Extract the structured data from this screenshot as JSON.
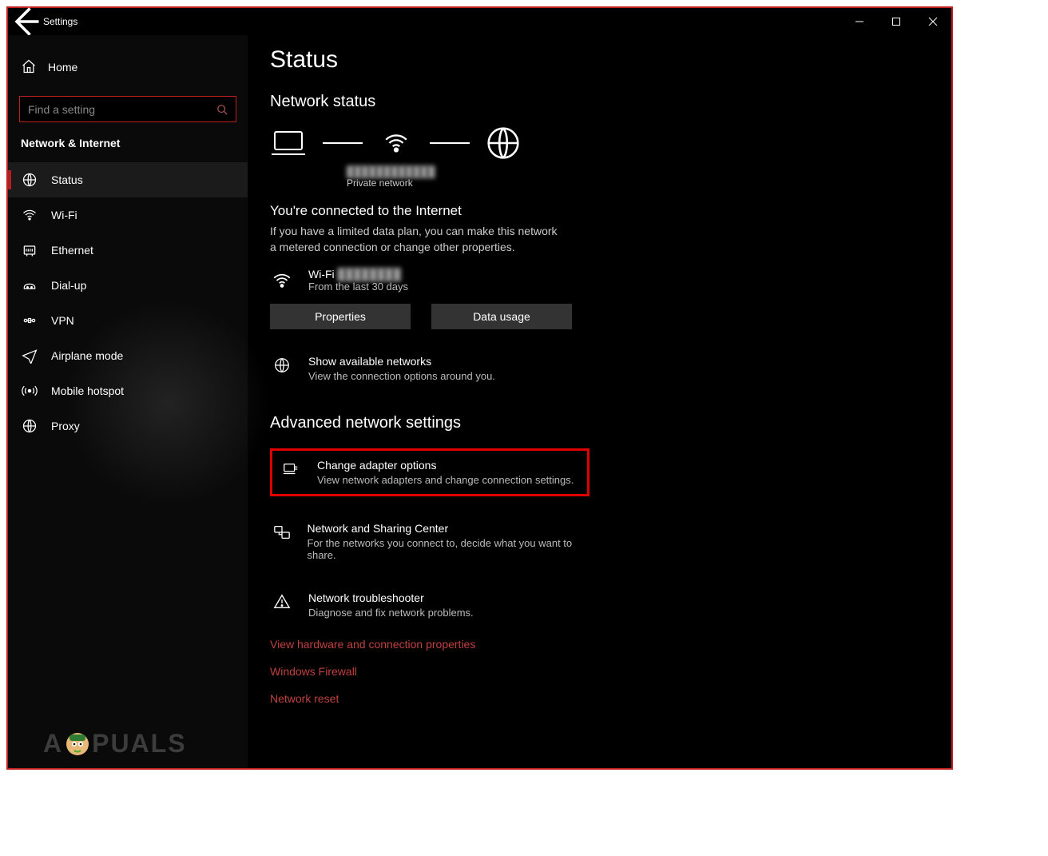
{
  "window": {
    "title": "Settings"
  },
  "sidebar": {
    "home_label": "Home",
    "search_placeholder": "Find a setting",
    "category_label": "Network & Internet",
    "items": [
      {
        "label": "Status"
      },
      {
        "label": "Wi-Fi"
      },
      {
        "label": "Ethernet"
      },
      {
        "label": "Dial-up"
      },
      {
        "label": "VPN"
      },
      {
        "label": "Airplane mode"
      },
      {
        "label": "Mobile hotspot"
      },
      {
        "label": "Proxy"
      }
    ]
  },
  "main": {
    "page_title": "Status",
    "network_status_heading": "Network status",
    "network_name": "████████████",
    "network_type_label": "Private network",
    "connected_title": "You're connected to the Internet",
    "connected_sub": "If you have a limited data plan, you can make this network a metered connection or change other properties.",
    "wifi_label": "Wi-Fi",
    "wifi_ssid": "████████",
    "wifi_sub": "From the last 30 days",
    "properties_btn": "Properties",
    "data_usage_btn": "Data usage",
    "show_networks_title": "Show available networks",
    "show_networks_sub": "View the connection options around you.",
    "advanced_heading": "Advanced network settings",
    "change_adapter_title": "Change adapter options",
    "change_adapter_sub": "View network adapters and change connection settings.",
    "sharing_center_title": "Network and Sharing Center",
    "sharing_center_sub": "For the networks you connect to, decide what you want to share.",
    "troubleshooter_title": "Network troubleshooter",
    "troubleshooter_sub": "Diagnose and fix network problems.",
    "link_hardware": "View hardware and connection properties",
    "link_firewall": "Windows Firewall",
    "link_reset": "Network reset"
  },
  "watermark": {
    "left": "A",
    "right": "PUALS"
  }
}
